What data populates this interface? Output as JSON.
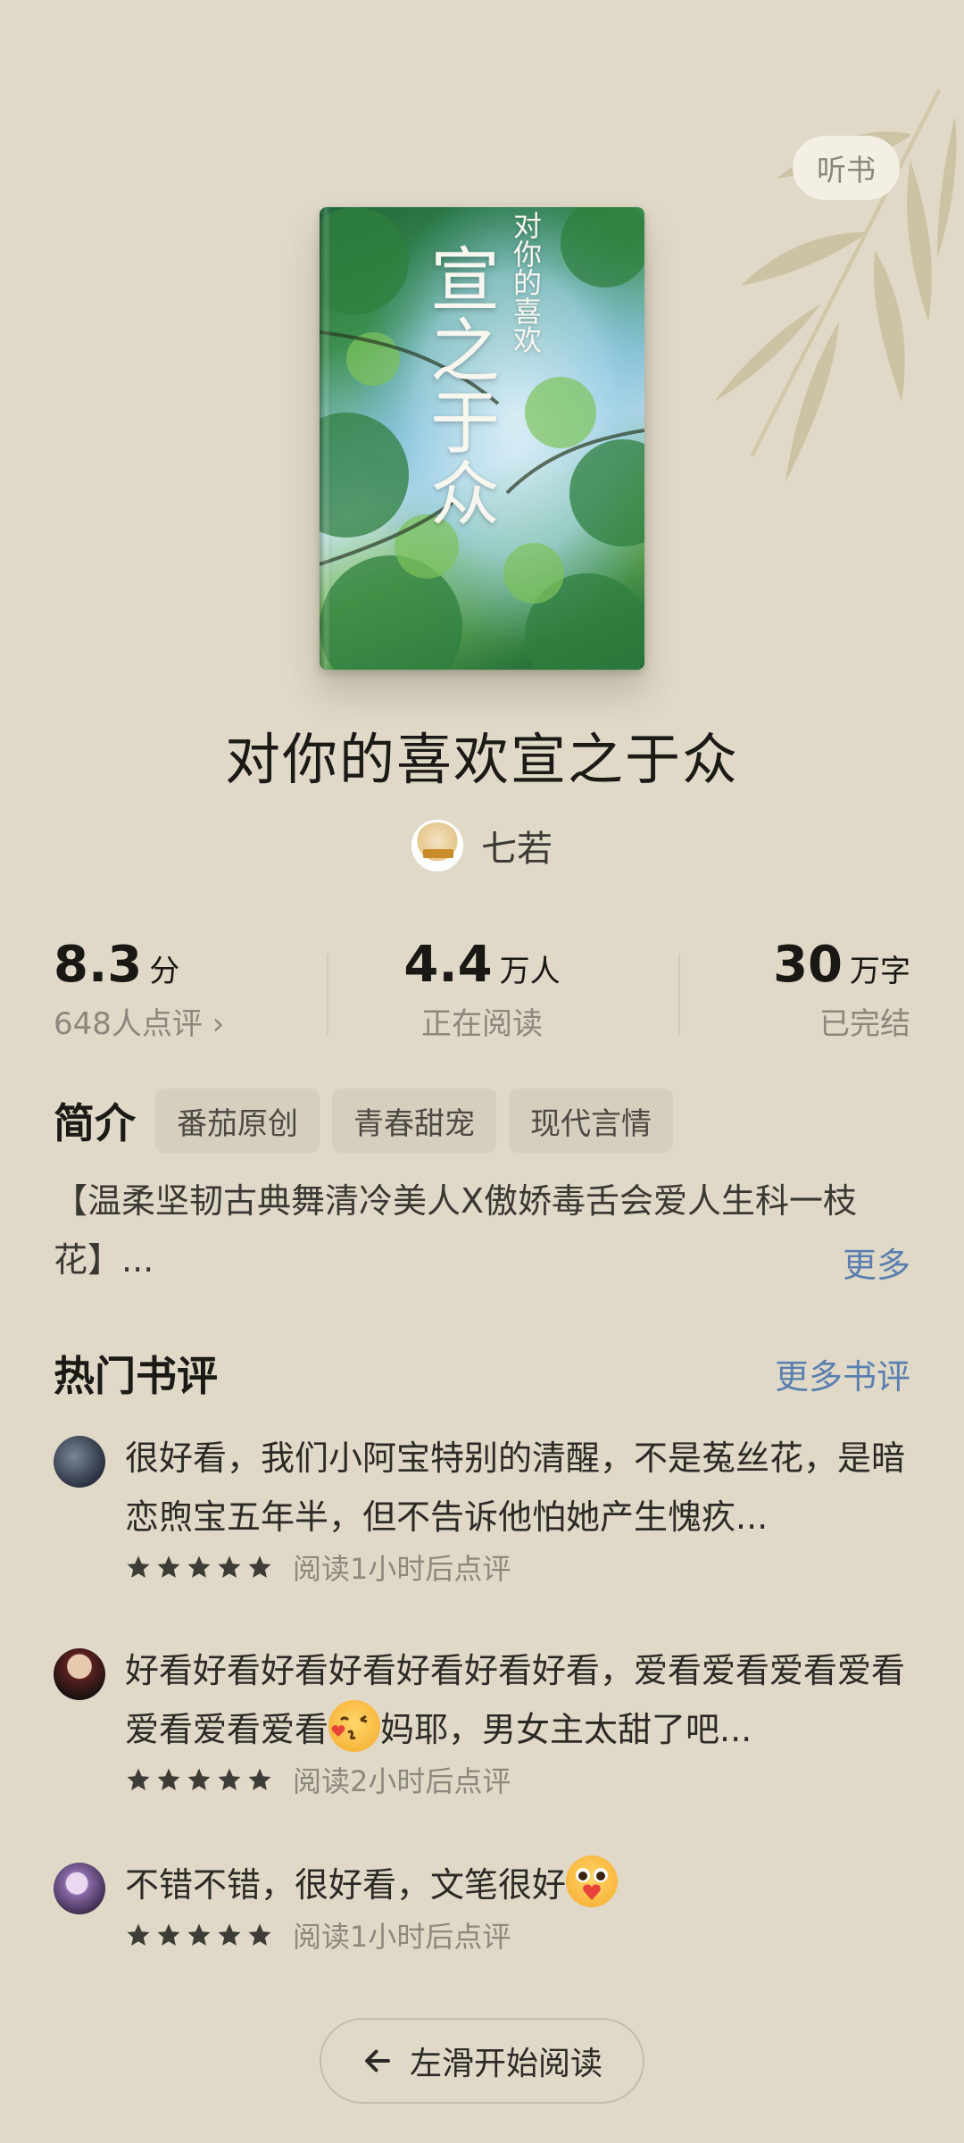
{
  "header": {
    "audio_button": "听书"
  },
  "book": {
    "cover_title": "宣之于众",
    "cover_subtitle": "对你的喜欢",
    "title": "对你的喜欢宣之于众",
    "author": "七若",
    "author_avatar_icon": "author-avatar-icon"
  },
  "stats": {
    "rating": {
      "value": "8.3",
      "unit": "分",
      "sub": "648人点评 ›"
    },
    "readers": {
      "value": "4.4",
      "unit": "万人",
      "sub": "正在阅读"
    },
    "words": {
      "value": "30",
      "unit": "万字",
      "sub": "已完结"
    }
  },
  "intro": {
    "label": "简介",
    "tags": [
      "番茄原创",
      "青春甜宠",
      "现代言情"
    ],
    "synopsis": "【温柔坚韧古典舞清冷美人X傲娇毒舌会爱人生科一枝花】...",
    "more": "更多"
  },
  "hot_reviews": {
    "title": "热门书评",
    "more": "更多书评",
    "items": [
      {
        "text": "很好看，我们小阿宝特别的清醒，不是菟丝花，是暗恋煦宝五年半，但不告诉他怕她产生愧疚...",
        "stars": 5,
        "time": "阅读1小时后点评"
      },
      {
        "text_before": "好看好看好看好看好看好看好看，爱看爱看爱看爱看爱看爱看爱看",
        "emoji": "kiss-emoji",
        "text_after": "妈耶，男女主太甜了吧...",
        "stars": 5,
        "time": "阅读2小时后点评"
      },
      {
        "text_before": "不错不错，很好看，文笔很好",
        "emoji": "love-emoji",
        "stars": 5,
        "time": "阅读1小时后点评"
      }
    ]
  },
  "footer": {
    "start_button": "左滑开始阅读",
    "arrow_icon": "arrow-left-icon"
  },
  "colors": {
    "background": "#e0d9c7",
    "link": "#5a7fb0",
    "tag_bg": "#d6cfbd"
  }
}
